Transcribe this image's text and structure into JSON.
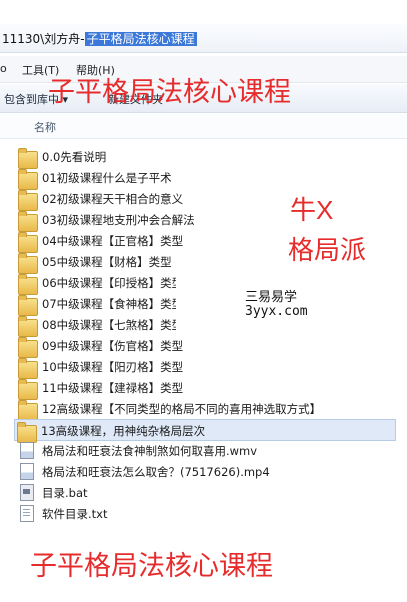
{
  "address": {
    "prefix": "11130\\刘方舟-",
    "selected": "子平格局法核心课程"
  },
  "menu": {
    "items": [
      "工具(T)",
      "帮助(H)"
    ],
    "partial_left": "o"
  },
  "toolbar": {
    "include_label": "包含到库中 ▾",
    "new_folder_label": "新建文件夹"
  },
  "column_header": {
    "name": "名称"
  },
  "files": [
    {
      "name": "0.0先看说明",
      "type": "folder"
    },
    {
      "name": "01初级课程什么是子平术",
      "type": "folder"
    },
    {
      "name": "02初级课程天干相合的意义",
      "type": "folder"
    },
    {
      "name": "03初级课程地支刑冲会合解法",
      "type": "folder"
    },
    {
      "name": "04中级课程【正官格】类型",
      "type": "folder"
    },
    {
      "name": "05中级课程【财格】类型",
      "type": "folder"
    },
    {
      "name": "06中级课程【印授格】类型",
      "type": "folder"
    },
    {
      "name": "07中级课程【食神格】类型",
      "type": "folder"
    },
    {
      "name": "08中级课程【七煞格】类型",
      "type": "folder"
    },
    {
      "name": "09中级课程【伤官格】类型",
      "type": "folder"
    },
    {
      "name": "10中级课程【阳刃格】类型",
      "type": "folder"
    },
    {
      "name": "11中级课程【建禄格】类型",
      "type": "folder"
    },
    {
      "name": "12高级课程【不同类型的格局不同的喜用神选取方式】",
      "type": "folder"
    },
    {
      "name": "13高级课程，用神纯杂格局层次",
      "type": "folder",
      "selected": true
    },
    {
      "name": "格局法和旺衰法食神制煞如何取喜用.wmv",
      "type": "video"
    },
    {
      "name": "格局法和旺衰法怎么取舍？(7517626).mp4",
      "type": "video"
    },
    {
      "name": "目录.bat",
      "type": "bat"
    },
    {
      "name": "软件目录.txt",
      "type": "txt"
    }
  ],
  "overlay": {
    "title_top": "子平格局法核心课程",
    "title_bottom": "子平格局法核心课程",
    "side_line1": "牛X",
    "side_line2": "格局派",
    "watermark_cn": "三易易学",
    "watermark_en": "3yyx.com",
    "text_color": "#e62c2c"
  }
}
